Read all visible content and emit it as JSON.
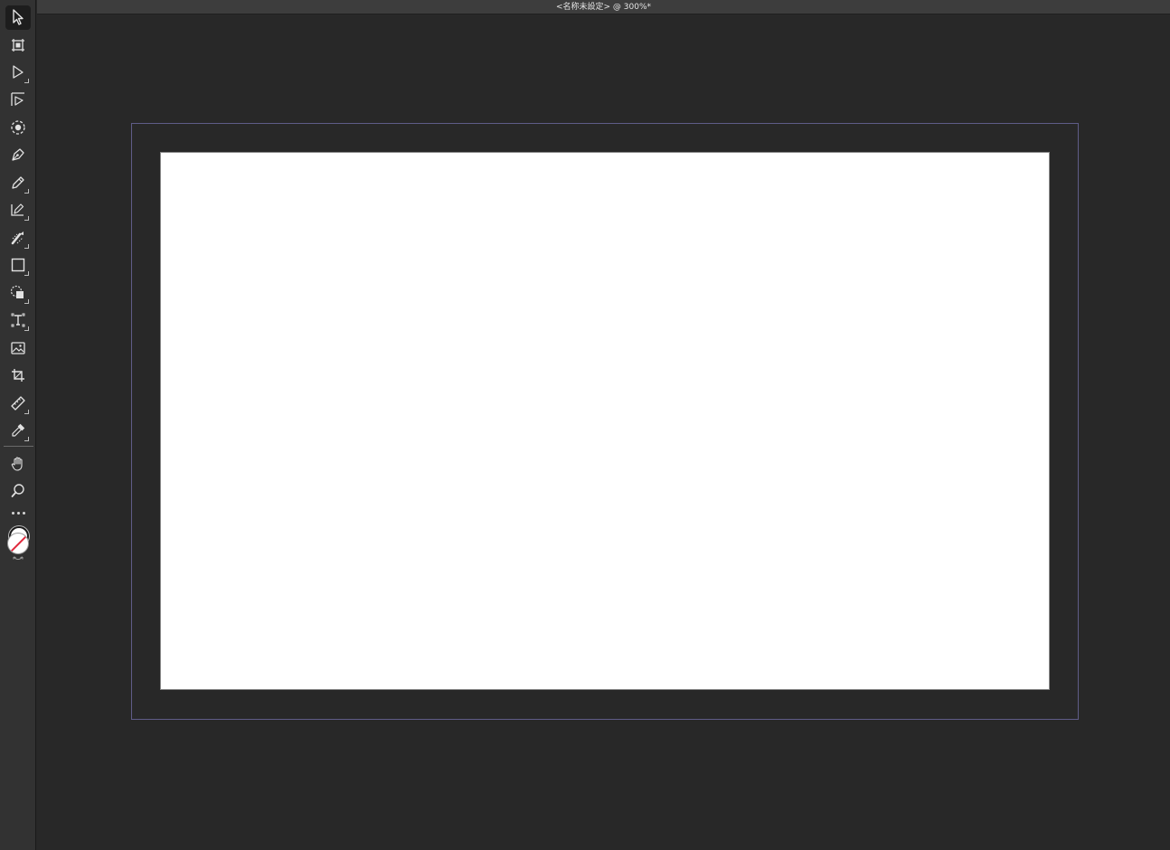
{
  "window": {
    "title": "<名称未設定> @ 300%*"
  },
  "colors": {
    "background": "#282828",
    "toolbar": "#323232",
    "titlebar": "#3d3d3d",
    "artboard": "#ffffff",
    "bleed_frame": "#5f5c88",
    "stroke_none_slash": "#e0283c"
  },
  "toolbar": {
    "tools": [
      {
        "name": "selection-tool",
        "icon": "arrow-pointer-icon",
        "active": true
      },
      {
        "name": "artboard-tool",
        "icon": "artboard-icon"
      },
      {
        "name": "direct-selection-tool",
        "icon": "hollow-arrow-icon"
      },
      {
        "name": "group-selection-tool",
        "icon": "group-select-icon"
      },
      {
        "name": "rotate-view-tool",
        "icon": "target-circle-icon"
      },
      {
        "name": "pen-tool",
        "icon": "pen-nib-icon"
      },
      {
        "name": "pencil-tool",
        "icon": "pencil-icon"
      },
      {
        "name": "shaper-tool",
        "icon": "shaper-icon"
      },
      {
        "name": "paintbrush-tool",
        "icon": "brush-icon"
      },
      {
        "name": "rectangle-tool",
        "icon": "rectangle-icon"
      },
      {
        "name": "shape-builder-tool",
        "icon": "shape-builder-icon"
      },
      {
        "name": "type-tool",
        "icon": "type-frame-icon"
      },
      {
        "name": "image-tool",
        "icon": "image-icon"
      },
      {
        "name": "crop-tool",
        "icon": "crop-icon"
      },
      {
        "name": "ruler-tool",
        "icon": "ruler-icon"
      },
      {
        "name": "eyedropper-tool",
        "icon": "eyedropper-icon"
      },
      {
        "name": "hand-tool",
        "icon": "hand-icon"
      },
      {
        "name": "zoom-tool",
        "icon": "magnifier-icon"
      },
      {
        "name": "more-tools",
        "icon": "ellipsis-icon"
      }
    ],
    "fill_stroke": {
      "fill": "#ffffff",
      "stroke": "none"
    }
  }
}
